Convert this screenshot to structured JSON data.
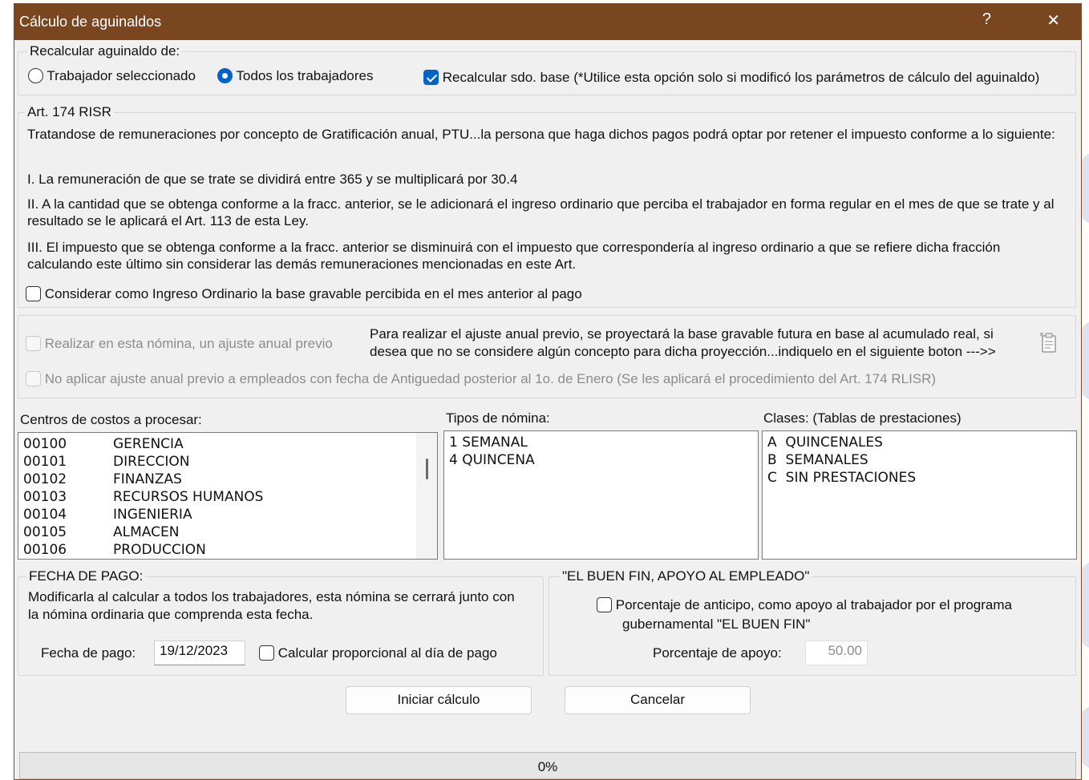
{
  "window": {
    "title": "Cálculo de aguinaldos",
    "help_glyph": "?",
    "close_glyph": "✕"
  },
  "recalc": {
    "legend": "Recalcular aguinaldo de:",
    "option_selected": "Trabajador seleccionado",
    "option_all": "Todos los trabajadores",
    "selected_option": "Todos los trabajadores",
    "recalc_base_label": "Recalcular sdo. base (*Utilice esta opción solo si modificó los parámetros de cálculo del aguinaldo)",
    "recalc_base_checked": true
  },
  "art174": {
    "legend": "Art. 174 RISR",
    "intro": "Tratandose de remuneraciones por concepto de Gratificación anual, PTU...la persona que haga dichos pagos podrá optar por retener el impuesto conforme a lo siguiente:",
    "point1": "I. La remuneración de que se trate se dividirá entre 365 y se multiplicará por 30.4",
    "point2": "II. A la cantidad que se obtenga conforme a la fracc. anterior, se le adicionará el ingreso ordinario que perciba el trabajador en forma regular en el mes de que se trate y al resultado se le aplicará el Art. 113 de esta Ley.",
    "point3": "III. El impuesto que se obtenga conforme a la fracc. anterior se disminuirá con el impuesto que correspondería al ingreso ordinario a que se refiere dicha fracción calculando este último sin considerar las demás remuneraciones mencionadas en este Art.",
    "consider_label": "Considerar como Ingreso Ordinario la base gravable percibida en el mes anterior al pago",
    "consider_checked": false
  },
  "ajuste": {
    "previo_label": "Realizar en esta nómina, un ajuste anual previo",
    "info_line1": "Para realizar el ajuste anual previo, se proyectará la base gravable futura en base al acumulado real, si",
    "info_line2": "desea que no se considere algún concepto para dicha proyección...indiquelo en el siguiente boton --->>",
    "no_aplicar_label": "No aplicar ajuste anual previo a empleados con fecha de Antiguedad posterior al 1o. de Enero (Se les aplicará el procedimiento del Art. 174 RLISR)",
    "concepts_icon": "clipboard-icon"
  },
  "centros": {
    "label": "Centros de costos a procesar:",
    "items": [
      {
        "code": "00100",
        "name": "GERENCIA"
      },
      {
        "code": "00101",
        "name": "DIRECCION"
      },
      {
        "code": "00102",
        "name": "FINANZAS"
      },
      {
        "code": "00103",
        "name": "RECURSOS HUMANOS"
      },
      {
        "code": "00104",
        "name": "INGENIERIA"
      },
      {
        "code": "00105",
        "name": "ALMACEN"
      },
      {
        "code": "00106",
        "name": "PRODUCCION"
      }
    ]
  },
  "tipos": {
    "label": "Tipos de nómina:",
    "items": [
      "1 SEMANAL",
      "4 QUINCENA"
    ]
  },
  "clases": {
    "label": "Clases: (Tablas de prestaciones)",
    "items": [
      "A  QUINCENALES",
      "B  SEMANALES",
      "C  SIN PRESTACIONES"
    ]
  },
  "fecha": {
    "legend": "FECHA DE PAGO:",
    "desc_line1": "Modificarla al calcular a todos los trabajadores, esta nómina se cerrará junto con",
    "desc_line2": "la nómina ordinaria que comprenda esta fecha.",
    "field_label": "Fecha de pago:",
    "value": "19/12/2023",
    "proporcional_label": "Calcular proporcional al día de pago",
    "proporcional_checked": false
  },
  "buenfin": {
    "legend": "\"EL BUEN FIN, APOYO AL EMPLEADO\"",
    "check_line1": "Porcentaje de anticipo, como apoyo al trabajador por el programa",
    "check_line2": "gubernamental \"EL BUEN FIN\"",
    "checked": false,
    "pct_label": "Porcentaje de apoyo:",
    "pct_value": "50.00"
  },
  "actions": {
    "start_label": "Iniciar cálculo",
    "cancel_label": "Cancelar"
  },
  "progress": {
    "text": "0%",
    "value": 0
  },
  "colors": {
    "titlebar": "#7a461f",
    "accent": "#0063c9",
    "dialog_bg": "#f0f0f0"
  }
}
